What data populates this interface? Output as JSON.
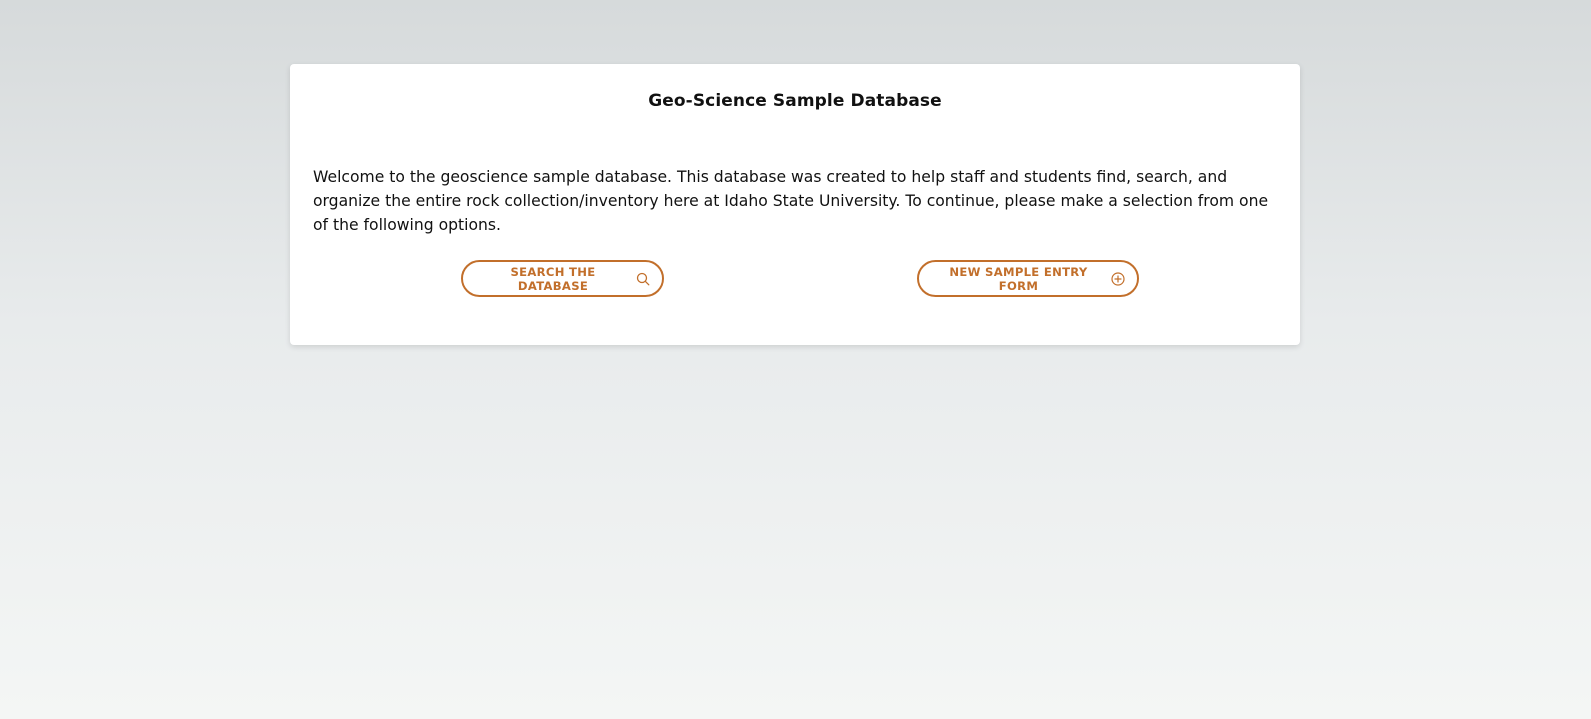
{
  "page": {
    "title": "Geo-Science Sample Database",
    "intro": "Welcome to the geoscience sample database. This database was created to help staff and students find, search, and organize the entire rock collection/inventory here at Idaho State University. To continue, please make a selection from one of the following options."
  },
  "actions": {
    "search": {
      "label": "SEARCH THE DATABASE",
      "icon": "search-icon"
    },
    "new_entry": {
      "label": "NEW SAMPLE ENTRY FORM",
      "icon": "plus-circle-icon"
    }
  },
  "colors": {
    "accent": "#c26f2b",
    "card": "#ffffff",
    "background_top": "#d6dadb",
    "background_bottom": "#f4f6f5"
  }
}
